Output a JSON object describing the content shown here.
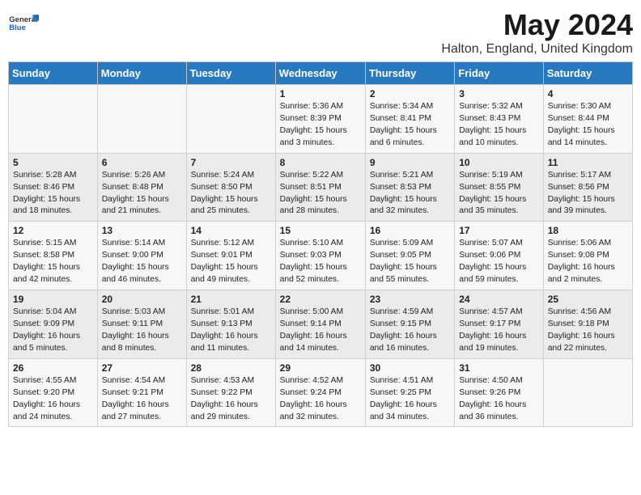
{
  "logo": {
    "line1": "General",
    "line2": "Blue"
  },
  "title": "May 2024",
  "location": "Halton, England, United Kingdom",
  "days_of_week": [
    "Sunday",
    "Monday",
    "Tuesday",
    "Wednesday",
    "Thursday",
    "Friday",
    "Saturday"
  ],
  "weeks": [
    [
      {
        "day": "",
        "content": ""
      },
      {
        "day": "",
        "content": ""
      },
      {
        "day": "",
        "content": ""
      },
      {
        "day": "1",
        "content": "Sunrise: 5:36 AM\nSunset: 8:39 PM\nDaylight: 15 hours\nand 3 minutes."
      },
      {
        "day": "2",
        "content": "Sunrise: 5:34 AM\nSunset: 8:41 PM\nDaylight: 15 hours\nand 6 minutes."
      },
      {
        "day": "3",
        "content": "Sunrise: 5:32 AM\nSunset: 8:43 PM\nDaylight: 15 hours\nand 10 minutes."
      },
      {
        "day": "4",
        "content": "Sunrise: 5:30 AM\nSunset: 8:44 PM\nDaylight: 15 hours\nand 14 minutes."
      }
    ],
    [
      {
        "day": "5",
        "content": "Sunrise: 5:28 AM\nSunset: 8:46 PM\nDaylight: 15 hours\nand 18 minutes."
      },
      {
        "day": "6",
        "content": "Sunrise: 5:26 AM\nSunset: 8:48 PM\nDaylight: 15 hours\nand 21 minutes."
      },
      {
        "day": "7",
        "content": "Sunrise: 5:24 AM\nSunset: 8:50 PM\nDaylight: 15 hours\nand 25 minutes."
      },
      {
        "day": "8",
        "content": "Sunrise: 5:22 AM\nSunset: 8:51 PM\nDaylight: 15 hours\nand 28 minutes."
      },
      {
        "day": "9",
        "content": "Sunrise: 5:21 AM\nSunset: 8:53 PM\nDaylight: 15 hours\nand 32 minutes."
      },
      {
        "day": "10",
        "content": "Sunrise: 5:19 AM\nSunset: 8:55 PM\nDaylight: 15 hours\nand 35 minutes."
      },
      {
        "day": "11",
        "content": "Sunrise: 5:17 AM\nSunset: 8:56 PM\nDaylight: 15 hours\nand 39 minutes."
      }
    ],
    [
      {
        "day": "12",
        "content": "Sunrise: 5:15 AM\nSunset: 8:58 PM\nDaylight: 15 hours\nand 42 minutes."
      },
      {
        "day": "13",
        "content": "Sunrise: 5:14 AM\nSunset: 9:00 PM\nDaylight: 15 hours\nand 46 minutes."
      },
      {
        "day": "14",
        "content": "Sunrise: 5:12 AM\nSunset: 9:01 PM\nDaylight: 15 hours\nand 49 minutes."
      },
      {
        "day": "15",
        "content": "Sunrise: 5:10 AM\nSunset: 9:03 PM\nDaylight: 15 hours\nand 52 minutes."
      },
      {
        "day": "16",
        "content": "Sunrise: 5:09 AM\nSunset: 9:05 PM\nDaylight: 15 hours\nand 55 minutes."
      },
      {
        "day": "17",
        "content": "Sunrise: 5:07 AM\nSunset: 9:06 PM\nDaylight: 15 hours\nand 59 minutes."
      },
      {
        "day": "18",
        "content": "Sunrise: 5:06 AM\nSunset: 9:08 PM\nDaylight: 16 hours\nand 2 minutes."
      }
    ],
    [
      {
        "day": "19",
        "content": "Sunrise: 5:04 AM\nSunset: 9:09 PM\nDaylight: 16 hours\nand 5 minutes."
      },
      {
        "day": "20",
        "content": "Sunrise: 5:03 AM\nSunset: 9:11 PM\nDaylight: 16 hours\nand 8 minutes."
      },
      {
        "day": "21",
        "content": "Sunrise: 5:01 AM\nSunset: 9:13 PM\nDaylight: 16 hours\nand 11 minutes."
      },
      {
        "day": "22",
        "content": "Sunrise: 5:00 AM\nSunset: 9:14 PM\nDaylight: 16 hours\nand 14 minutes."
      },
      {
        "day": "23",
        "content": "Sunrise: 4:59 AM\nSunset: 9:15 PM\nDaylight: 16 hours\nand 16 minutes."
      },
      {
        "day": "24",
        "content": "Sunrise: 4:57 AM\nSunset: 9:17 PM\nDaylight: 16 hours\nand 19 minutes."
      },
      {
        "day": "25",
        "content": "Sunrise: 4:56 AM\nSunset: 9:18 PM\nDaylight: 16 hours\nand 22 minutes."
      }
    ],
    [
      {
        "day": "26",
        "content": "Sunrise: 4:55 AM\nSunset: 9:20 PM\nDaylight: 16 hours\nand 24 minutes."
      },
      {
        "day": "27",
        "content": "Sunrise: 4:54 AM\nSunset: 9:21 PM\nDaylight: 16 hours\nand 27 minutes."
      },
      {
        "day": "28",
        "content": "Sunrise: 4:53 AM\nSunset: 9:22 PM\nDaylight: 16 hours\nand 29 minutes."
      },
      {
        "day": "29",
        "content": "Sunrise: 4:52 AM\nSunset: 9:24 PM\nDaylight: 16 hours\nand 32 minutes."
      },
      {
        "day": "30",
        "content": "Sunrise: 4:51 AM\nSunset: 9:25 PM\nDaylight: 16 hours\nand 34 minutes."
      },
      {
        "day": "31",
        "content": "Sunrise: 4:50 AM\nSunset: 9:26 PM\nDaylight: 16 hours\nand 36 minutes."
      },
      {
        "day": "",
        "content": ""
      }
    ]
  ]
}
